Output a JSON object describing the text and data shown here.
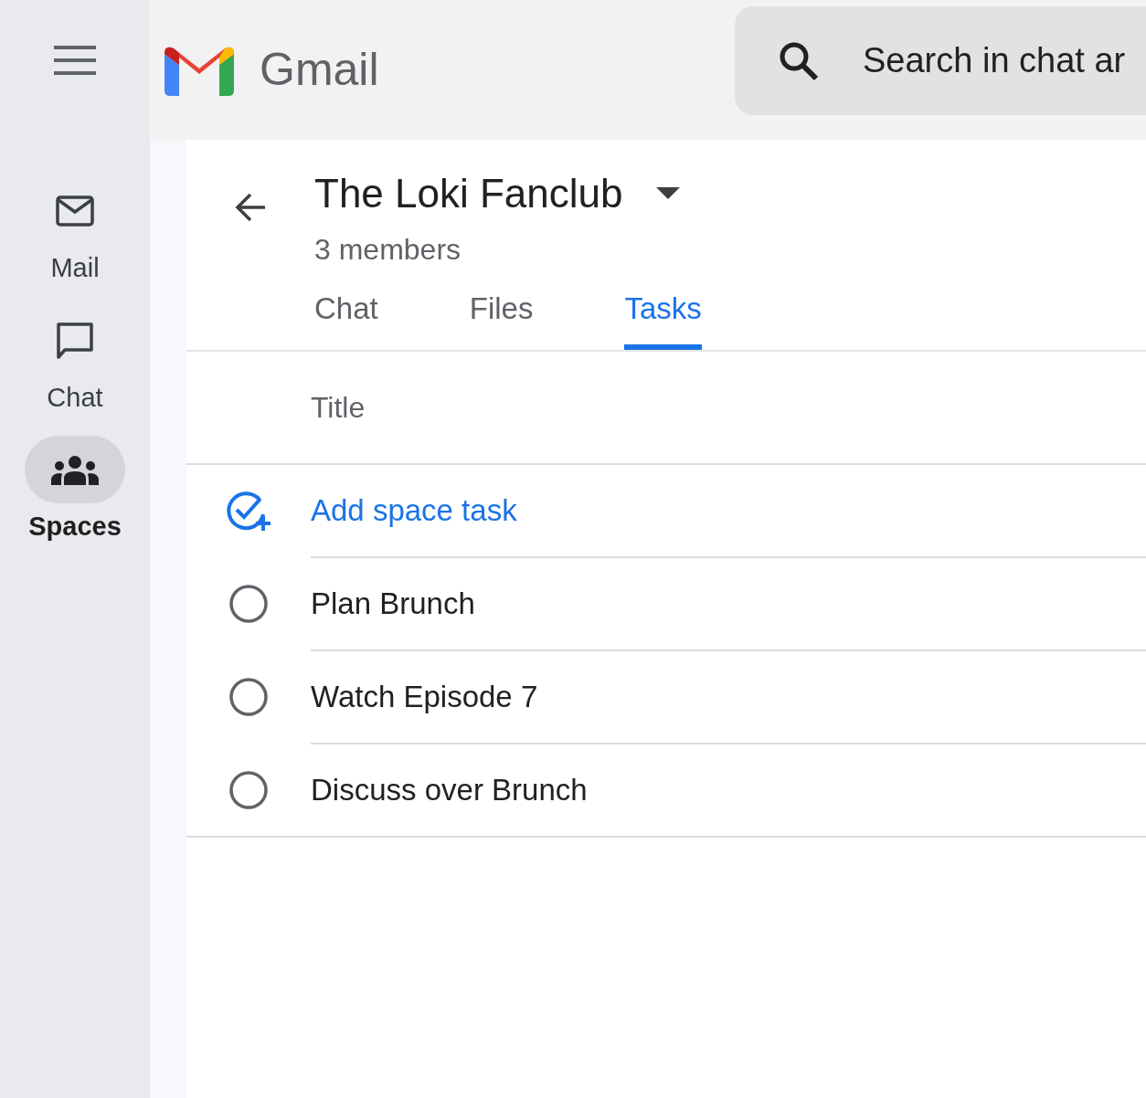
{
  "header": {
    "logo_text": "Gmail",
    "search": {
      "placeholder": "Search in chat ar"
    }
  },
  "rail": [
    {
      "kind": "mail",
      "label": "Mail",
      "selected": false
    },
    {
      "kind": "chat",
      "label": "Chat",
      "selected": false
    },
    {
      "kind": "spaces",
      "label": "Spaces",
      "selected": true
    }
  ],
  "space": {
    "title": "The Loki Fanclub",
    "members": "3 members"
  },
  "tabs": [
    {
      "label": "Chat",
      "selected": false
    },
    {
      "label": "Files",
      "selected": false
    },
    {
      "label": "Tasks",
      "selected": true
    }
  ],
  "tasks": {
    "column": "Title",
    "add_label": "Add space task",
    "items": [
      {
        "title": "Plan Brunch",
        "completed": false
      },
      {
        "title": "Watch Episode 7",
        "completed": false
      },
      {
        "title": "Discuss over Brunch",
        "completed": false
      }
    ]
  }
}
